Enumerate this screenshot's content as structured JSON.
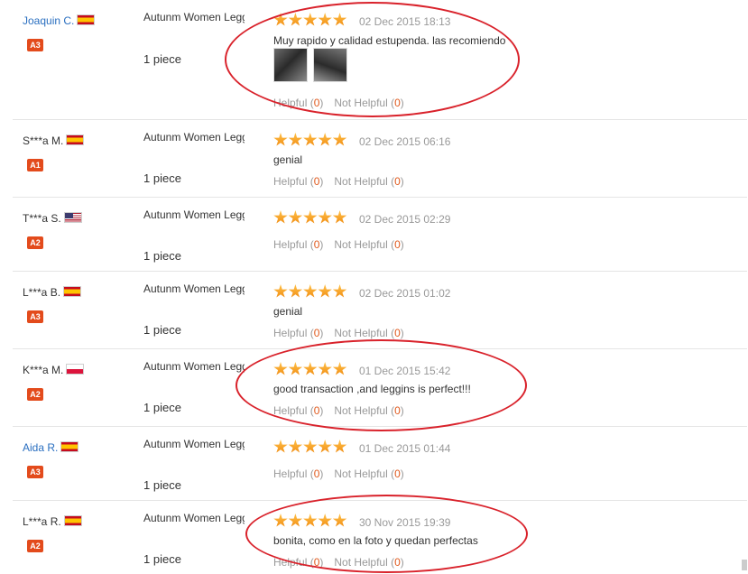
{
  "reviews": [
    {
      "user": "Joaquin C.",
      "flag": "es",
      "level": "A3",
      "product": "Autunm Women Leggings American",
      "qty": "1 piece",
      "date": "02 Dec 2015 18:13",
      "comment": "Muy rapido y calidad estupenda. las recomiendo",
      "helpful_label": "Helpful",
      "helpful_count": "0",
      "not_helpful_label": "Not Helpful",
      "not_helpful_count": "0",
      "rating": 5,
      "photos": 2
    },
    {
      "user": "S***a M.",
      "flag": "es",
      "level": "A1",
      "product": "Autunm Women Leggings American",
      "qty": "1 piece",
      "date": "02 Dec 2015 06:16",
      "comment": "genial",
      "helpful_label": "Helpful",
      "helpful_count": "0",
      "not_helpful_label": "Not Helpful",
      "not_helpful_count": "0",
      "rating": 5
    },
    {
      "user": "T***a S.",
      "flag": "us",
      "level": "A2",
      "product": "Autunm Women Leggings American",
      "qty": "1 piece",
      "date": "02 Dec 2015 02:29",
      "comment": "",
      "helpful_label": "Helpful",
      "helpful_count": "0",
      "not_helpful_label": "Not Helpful",
      "not_helpful_count": "0",
      "rating": 5
    },
    {
      "user": "L***a B.",
      "flag": "es",
      "level": "A3",
      "product": "Autunm Women Leggings American",
      "qty": "1 piece",
      "date": "02 Dec 2015 01:02",
      "comment": "genial",
      "helpful_label": "Helpful",
      "helpful_count": "0",
      "not_helpful_label": "Not Helpful",
      "not_helpful_count": "0",
      "rating": 5
    },
    {
      "user": "K***a M.",
      "flag": "pl",
      "level": "A2",
      "product": "Autunm Women Leggings American",
      "qty": "1 piece",
      "date": "01 Dec 2015 15:42",
      "comment": "good transaction ,and leggins is perfect!!!",
      "helpful_label": "Helpful",
      "helpful_count": "0",
      "not_helpful_label": "Not Helpful",
      "not_helpful_count": "0",
      "rating": 5
    },
    {
      "user": "Aida R.",
      "flag": "es",
      "level": "A3",
      "product": "Autunm Women Leggings American",
      "qty": "1 piece",
      "date": "01 Dec 2015 01:44",
      "comment": "",
      "helpful_label": "Helpful",
      "helpful_count": "0",
      "not_helpful_label": "Not Helpful",
      "not_helpful_count": "0",
      "rating": 5
    },
    {
      "user": "L***a R.",
      "flag": "es",
      "level": "A2",
      "product": "Autunm Women Leggings American",
      "qty": "1 piece",
      "date": "30 Nov 2015 19:39",
      "comment": "bonita, como en la foto y quedan perfectas",
      "helpful_label": "Helpful",
      "helpful_count": "0",
      "not_helpful_label": "Not Helpful",
      "not_helpful_count": "0",
      "rating": 5
    }
  ],
  "colors": {
    "accent": "#e05a1e",
    "level_badge": "#e34b1c",
    "link": "#2a6fc0",
    "annotation": "#d9222b",
    "star": "#f5a01c"
  }
}
